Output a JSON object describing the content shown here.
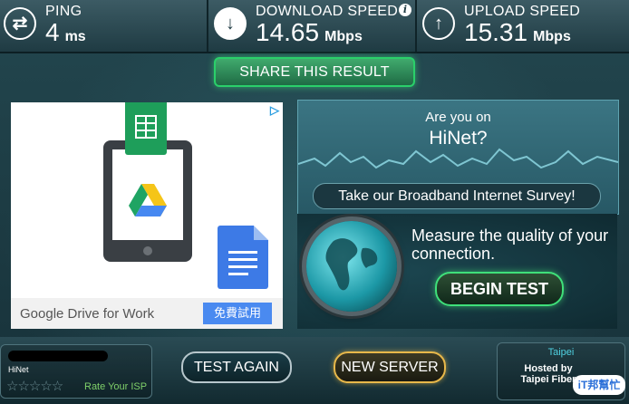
{
  "header": {
    "ping": {
      "label": "PING",
      "value": "4",
      "unit": "ms",
      "icon": "swap-arrows-icon"
    },
    "download": {
      "label": "DOWNLOAD SPEED",
      "value": "14.65",
      "unit": "Mbps",
      "icon": "down-arrow-icon"
    },
    "upload": {
      "label": "UPLOAD SPEED",
      "value": "15.31",
      "unit": "Mbps",
      "icon": "up-arrow-icon"
    },
    "info_glyph": "i"
  },
  "share": {
    "label": "SHARE THIS RESULT"
  },
  "ad": {
    "text": "Google Drive for Work",
    "cta": "免費試用"
  },
  "survey": {
    "question": "Are you on",
    "isp": "HiNet?",
    "button": "Take our Broadband Internet Survey!"
  },
  "measure": {
    "title": "Measure the quality of your connection.",
    "button": "BEGIN TEST"
  },
  "bottom": {
    "isp_name": "HiNet",
    "rate_label": "Rate Your ISP",
    "stars": "☆☆☆☆☆",
    "test_again": "TEST AGAIN",
    "new_server": "NEW SERVER",
    "server_city": "Taipei",
    "hosted_by": "Hosted by",
    "host_name": "Taipei Fiber",
    "watermark": "iT邦幫忙"
  },
  "colors": {
    "accent_green": "#2ad06a",
    "accent_gold": "#e8b84a",
    "panel_teal": "#3b7583"
  }
}
